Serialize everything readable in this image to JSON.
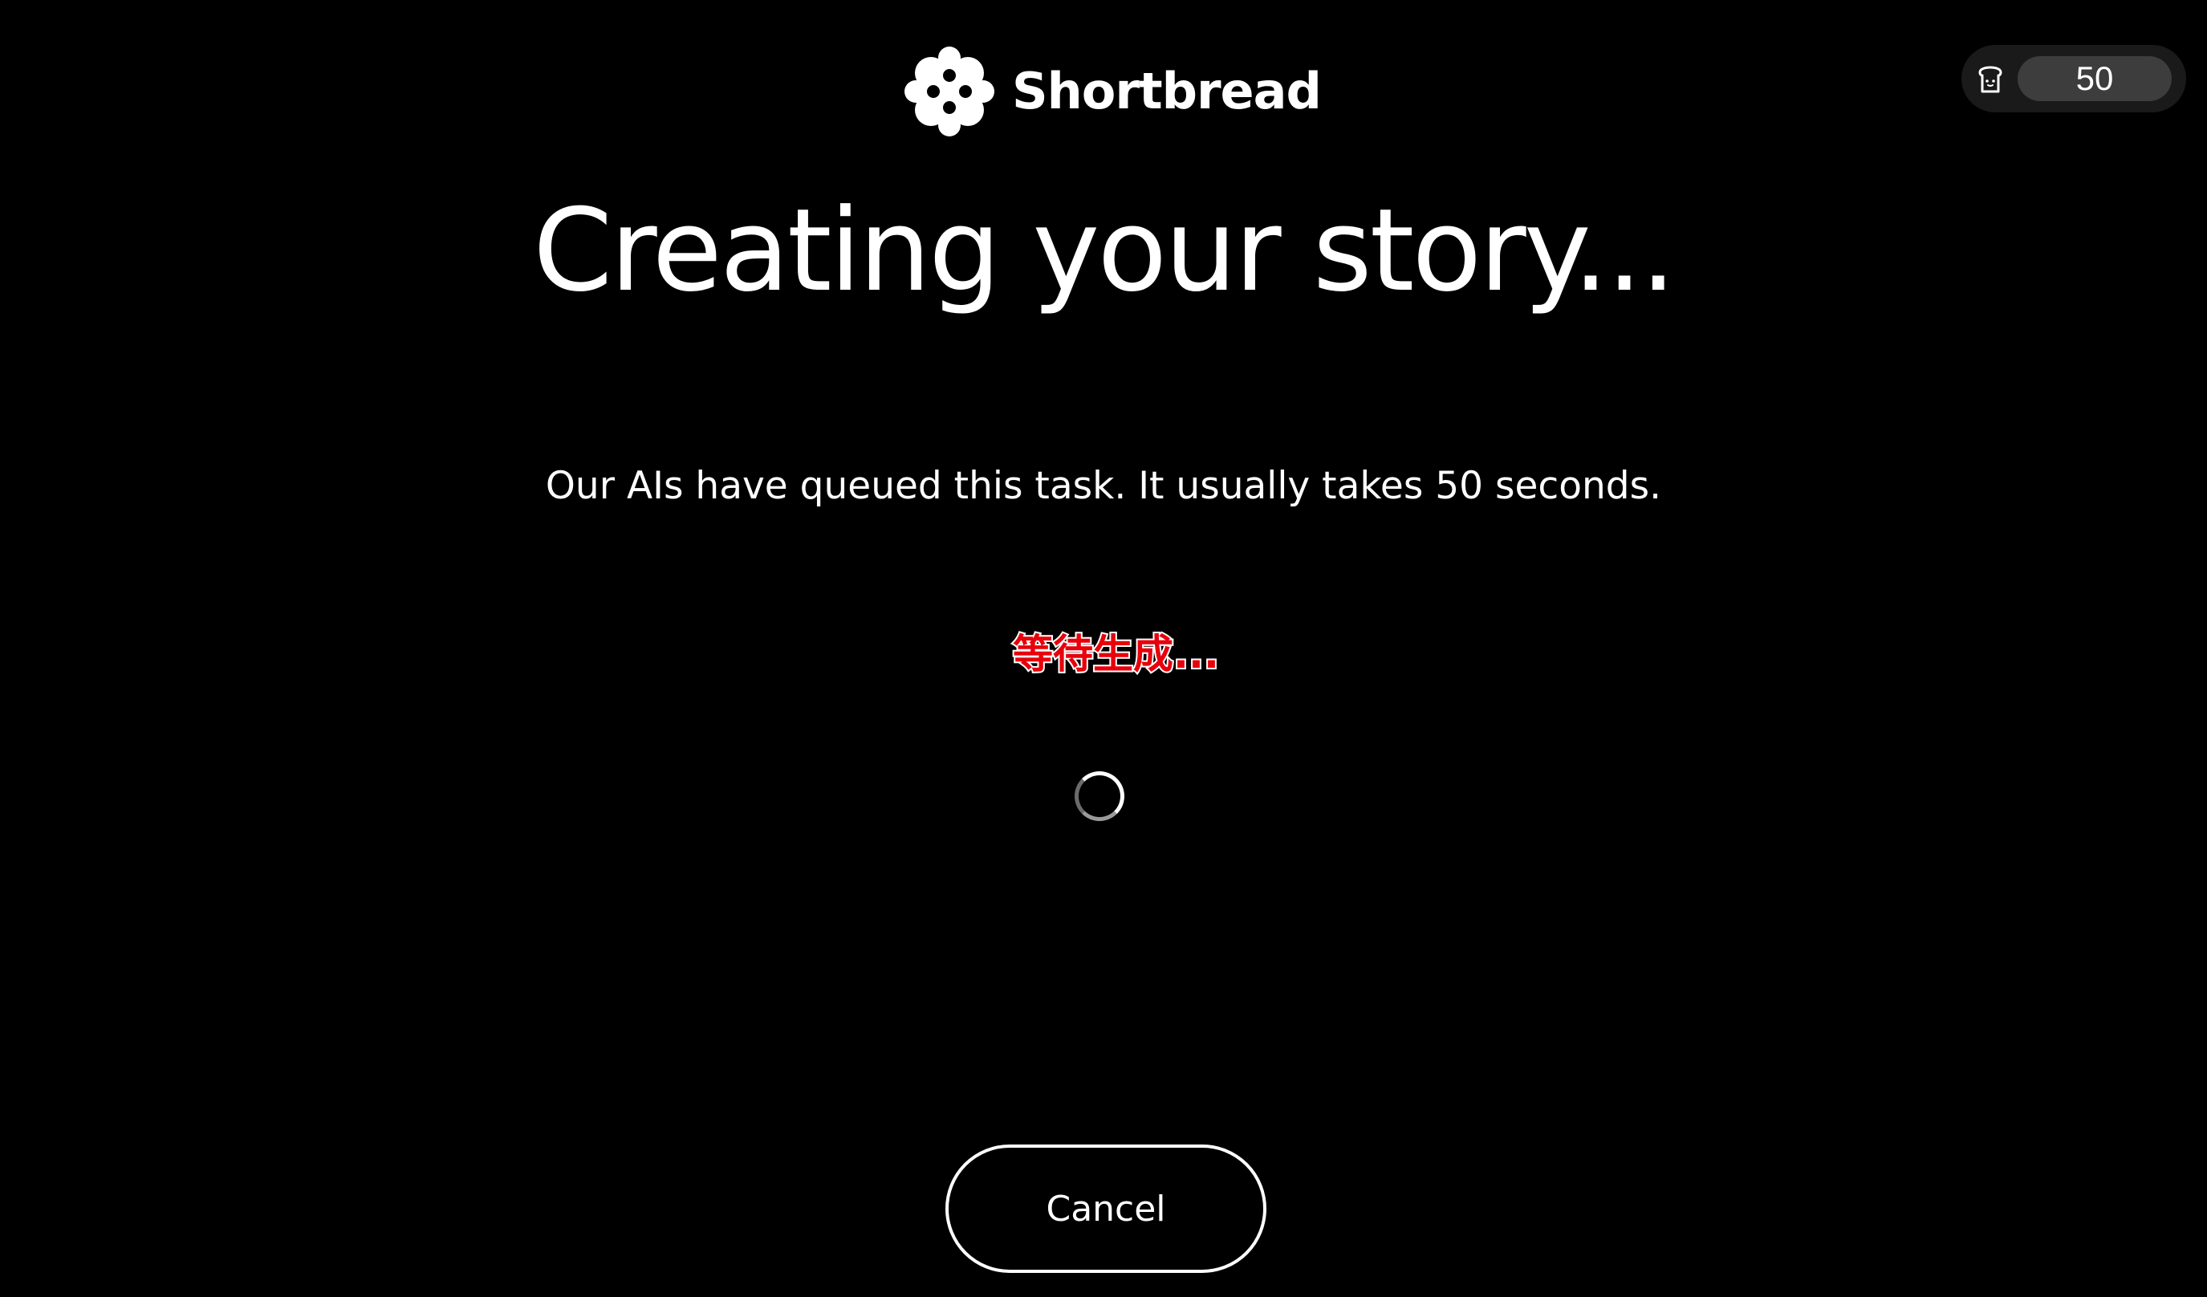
{
  "header": {
    "brand_name": "Shortbread",
    "logo_icon": "shortbread-cookie-logo",
    "credits": {
      "icon": "toast-bread-icon",
      "value": "50"
    }
  },
  "main": {
    "title": "Creating your story...",
    "subtitle": "Our AIs have queued this task. It usually takes 50 seconds.",
    "status_text": "等待生成...",
    "loading_icon": "spinner-icon"
  },
  "actions": {
    "cancel_label": "Cancel"
  },
  "colors": {
    "background": "#000000",
    "text": "#ffffff",
    "status_text": "#e8000b",
    "credits_bg": "#1a1a1a",
    "credits_pill": "#3d3d3d"
  }
}
